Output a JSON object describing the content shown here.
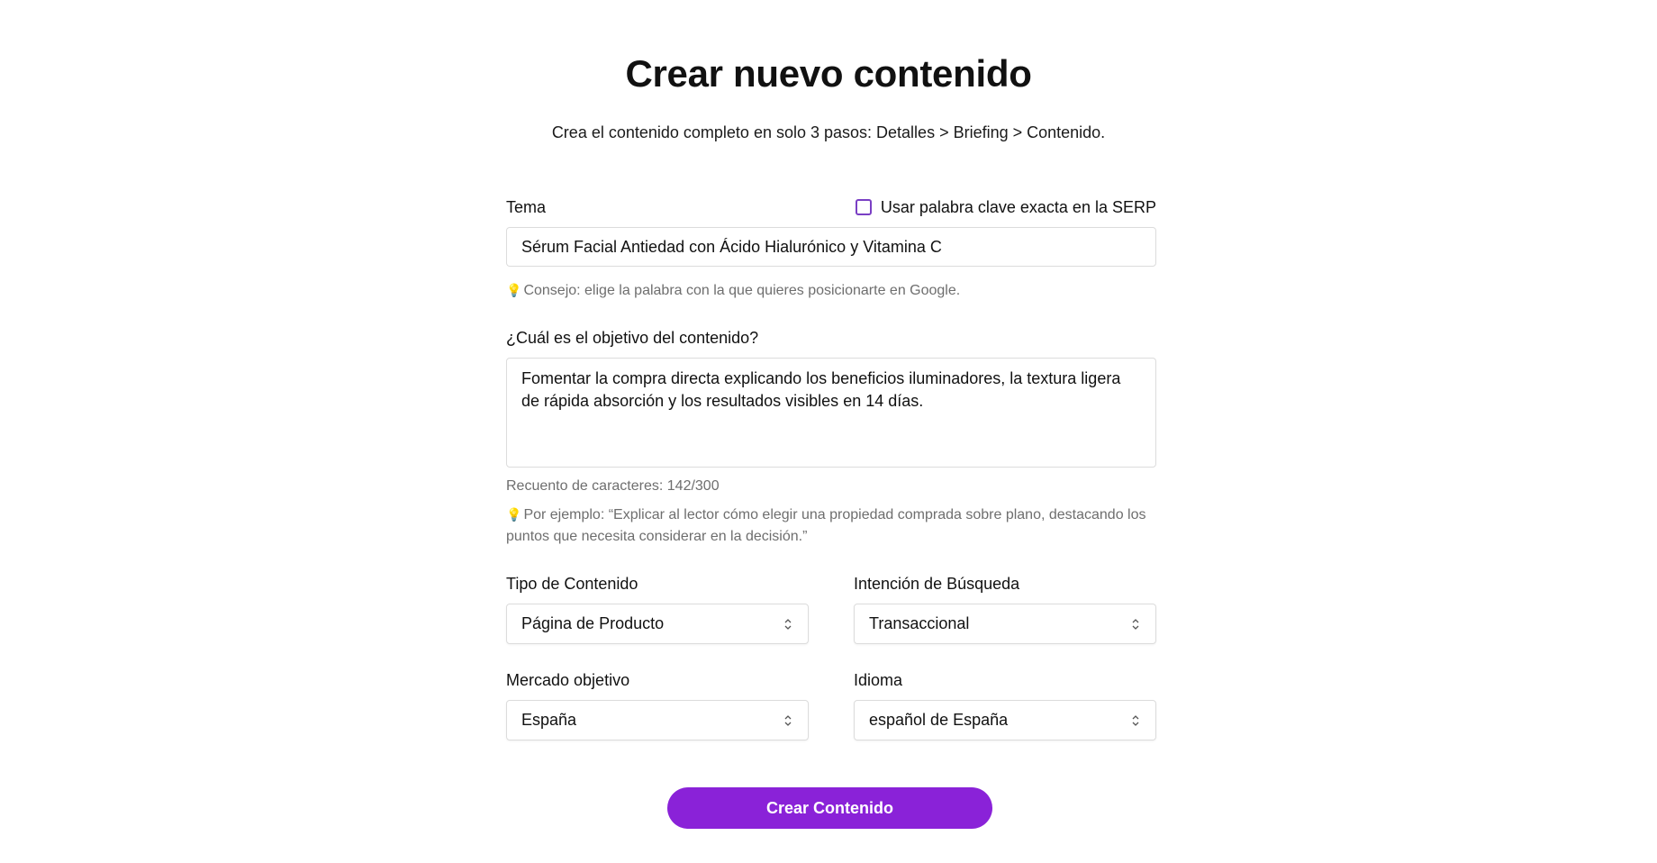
{
  "header": {
    "title": "Crear nuevo contenido",
    "subtitle": "Crea el contenido completo en solo 3 pasos: Detalles > Briefing > Contenido."
  },
  "topic": {
    "label": "Tema",
    "exact_keyword_label": "Usar palabra clave exacta en la SERP",
    "exact_keyword_checked": false,
    "value": "Sérum Facial Antiedad con Ácido Hialurónico y Vitamina C",
    "tip": "Consejo: elige la palabra con la que quieres posicionarte en Google."
  },
  "objective": {
    "label": "¿Cuál es el objetivo del contenido?",
    "value": "Fomentar la compra directa explicando los beneficios iluminadores, la textura ligera de rápida absorción y los resultados visibles en 14 días.",
    "char_count": "Recuento de caracteres: 142/300",
    "example": "Por ejemplo: “Explicar al lector cómo elegir una propiedad comprada sobre plano, destacando los puntos que necesita considerar en la decisión.”"
  },
  "content_type": {
    "label": "Tipo de Contenido",
    "value": "Página de Producto"
  },
  "search_intent": {
    "label": "Intención de Búsqueda",
    "value": "Transaccional"
  },
  "market": {
    "label": "Mercado objetivo",
    "value": "España"
  },
  "language": {
    "label": "Idioma",
    "value": "español de España"
  },
  "submit": {
    "label": "Crear Contenido"
  },
  "colors": {
    "accent": "#8a22d8",
    "checkbox_border": "#7a3fc4",
    "hint_text": "#6e6e6e",
    "tip_icon": "#e8b428"
  },
  "icons": {
    "tip": "lightbulb-icon",
    "select": "chevron-up-down-icon"
  }
}
